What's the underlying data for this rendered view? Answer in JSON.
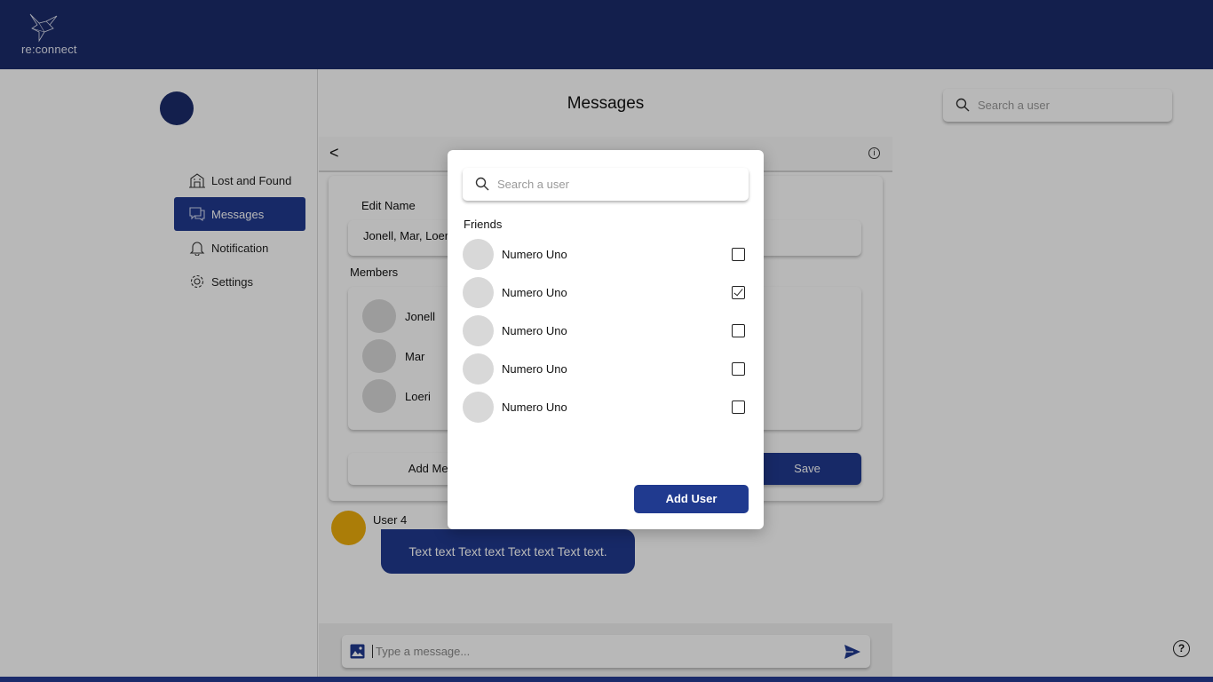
{
  "app": {
    "logo_text": "re:connect"
  },
  "sidebar": {
    "items": [
      {
        "label": "Lost and Found",
        "icon": "building-icon",
        "active": false
      },
      {
        "label": "Messages",
        "icon": "chat-icon",
        "active": true
      },
      {
        "label": "Notification",
        "icon": "bell-icon",
        "active": false
      },
      {
        "label": "Settings",
        "icon": "gear-icon",
        "active": false
      }
    ]
  },
  "main": {
    "title": "Messages",
    "back_label": "<",
    "edit_panel": {
      "name_label": "Edit Name",
      "name_value": "Jonell, Mar, Loeri",
      "members_label": "Members",
      "members": [
        "Jonell",
        "Mar",
        "Loeri"
      ],
      "add_member_label": "Add Member",
      "save_label": "Save"
    },
    "message": {
      "user": "User 4",
      "text": "Text text Text text Text text Text text."
    },
    "composer": {
      "placeholder": "Type a message..."
    }
  },
  "right_search": {
    "placeholder": "Search a user"
  },
  "modal": {
    "search_placeholder": "Search a user",
    "friends_label": "Friends",
    "friends": [
      {
        "name": "Numero Uno",
        "checked": false
      },
      {
        "name": "Numero Uno",
        "checked": true
      },
      {
        "name": "Numero Uno",
        "checked": false
      },
      {
        "name": "Numero Uno",
        "checked": false
      },
      {
        "name": "Numero Uno",
        "checked": false
      }
    ],
    "add_user_label": "Add User"
  },
  "colors": {
    "brand": "#1b2b6b",
    "accent": "#203a8f",
    "message_avatar": "#eeae0c"
  }
}
